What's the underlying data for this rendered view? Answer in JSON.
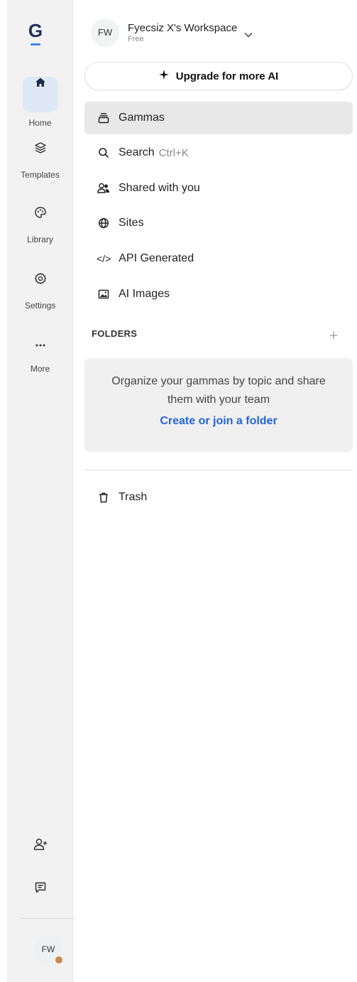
{
  "rail": {
    "logo": "G",
    "items": [
      {
        "label": "Home",
        "icon": "home-icon"
      },
      {
        "label": "Templates",
        "icon": "layers-icon"
      },
      {
        "label": "Library",
        "icon": "palette-icon"
      },
      {
        "label": "Settings",
        "icon": "gear-icon"
      },
      {
        "label": "More",
        "icon": "more-icon"
      }
    ],
    "bottom_icons": [
      "add-user-icon",
      "feedback-icon"
    ],
    "user_initials": "FW"
  },
  "workspace": {
    "initials": "FW",
    "name": "Fyecsiz X's Workspace",
    "plan": "Free"
  },
  "upgrade": {
    "icon": "sparkle-icon",
    "label": "Upgrade for more AI"
  },
  "nav": [
    {
      "label": "Gammas",
      "icon": "stack-icon",
      "active": true
    },
    {
      "label": "Search",
      "hint": "Ctrl+K",
      "icon": "search-icon"
    },
    {
      "label": "Shared with you",
      "icon": "shared-users-icon"
    },
    {
      "label": "Sites",
      "icon": "globe-icon"
    },
    {
      "label": "API Generated",
      "icon": "code-icon",
      "glyph": "</>"
    },
    {
      "label": "AI Images",
      "icon": "image-icon"
    }
  ],
  "folders": {
    "heading": "FOLDERS",
    "empty_message": "Organize your gammas by topic and share them with your team",
    "link": "Create or join a folder"
  },
  "trash": {
    "label": "Trash",
    "icon": "trash-icon"
  },
  "colors": {
    "rail_bg": "#f2f2f2",
    "home_active_bg": "#dfe9f6",
    "accent_link": "#2563d6",
    "logo": "#1d2f5c",
    "logo_bar": "#3b82f6"
  }
}
